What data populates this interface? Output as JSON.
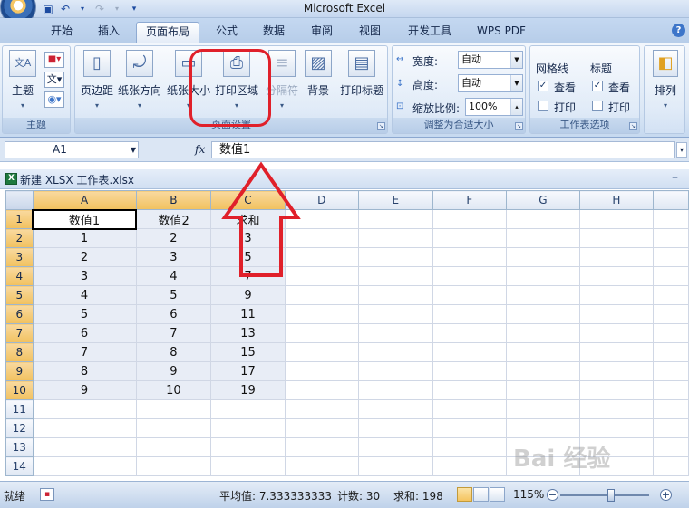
{
  "app": {
    "title": "Microsoft Excel"
  },
  "ribbon_tabs": [
    "开始",
    "插入",
    "页面布局",
    "公式",
    "数据",
    "审阅",
    "视图",
    "开发工具",
    "WPS PDF"
  ],
  "active_tab": "页面布局",
  "groups": {
    "theme": {
      "label": "主题",
      "theme_btn": "主题"
    },
    "page_setup": {
      "label": "页面设置",
      "margins": "页边距",
      "orientation": "纸张方向",
      "size": "纸张大小",
      "print_area": "打印区域",
      "breaks": "分隔符",
      "background": "背景",
      "print_titles": "打印标题"
    },
    "scale": {
      "label": "调整为合适大小",
      "width_label": "宽度:",
      "width_value": "自动",
      "height_label": "高度:",
      "height_value": "自动",
      "scale_label": "缩放比例:",
      "scale_value": "100%"
    },
    "sheet_options": {
      "label": "工作表选项",
      "gridlines": "网格线",
      "headings": "标题",
      "view": "查看",
      "print": "打印"
    },
    "arrange": {
      "label": "排列"
    }
  },
  "formula_bar": {
    "name_box": "A1",
    "fx": "fx",
    "formula": "数值1"
  },
  "workbook": {
    "title": "新建 XLSX 工作表.xlsx"
  },
  "grid": {
    "columns": [
      "A",
      "B",
      "C",
      "D",
      "E",
      "F",
      "G",
      "H"
    ],
    "rows": [
      [
        "数值1",
        "数值2",
        "求和"
      ],
      [
        "1",
        "2",
        "3"
      ],
      [
        "2",
        "3",
        "5"
      ],
      [
        "3",
        "4",
        "7"
      ],
      [
        "4",
        "5",
        "9"
      ],
      [
        "5",
        "6",
        "11"
      ],
      [
        "6",
        "7",
        "13"
      ],
      [
        "7",
        "8",
        "15"
      ],
      [
        "8",
        "9",
        "17"
      ],
      [
        "9",
        "10",
        "19"
      ]
    ],
    "row_count": 14
  },
  "status": {
    "ready": "就绪",
    "average": "平均值: 7.333333333",
    "count": "计数: 30",
    "sum": "求和: 198",
    "zoom": "115%"
  },
  "watermark": "Bai 经验",
  "colors": {
    "highlight": "#e0202a",
    "ribbon_bg": "#dce8f6",
    "selected_header": "#f5c45f"
  }
}
